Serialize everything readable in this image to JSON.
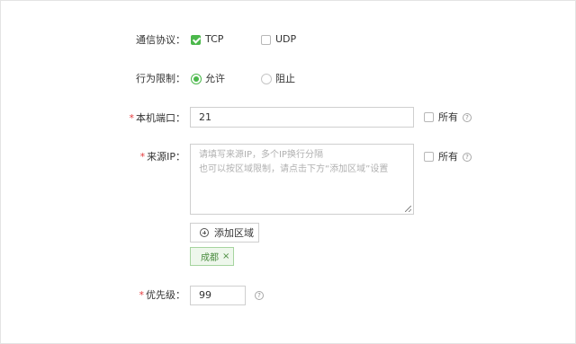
{
  "protocol": {
    "label": "通信协议：",
    "options": [
      {
        "text": "TCP",
        "checked": true
      },
      {
        "text": "UDP",
        "checked": false
      }
    ]
  },
  "behavior": {
    "label": "行为限制：",
    "options": [
      {
        "text": "允许",
        "selected": true
      },
      {
        "text": "阻止",
        "selected": false
      }
    ]
  },
  "local_port": {
    "required_mark": "*",
    "label": "本机端口：",
    "value": "21",
    "all_label": "所有",
    "help_symbol": "?"
  },
  "source_ip": {
    "required_mark": "*",
    "label": "来源IP：",
    "placeholder_line1": "请填写来源IP，多个IP换行分隔",
    "placeholder_line2": "也可以按区域限制，请点击下方“添加区域”设置",
    "all_label": "所有",
    "help_symbol": "?"
  },
  "add_region_button": "添加区域",
  "region_tags": [
    {
      "text": "成都",
      "remove": "×"
    }
  ],
  "priority": {
    "required_mark": "*",
    "label": "优先级：",
    "value": "99",
    "help_symbol": "?"
  },
  "colors": {
    "accent_green": "#4bb84b",
    "required_red": "#e4393c",
    "tag_bg": "#eef7ec",
    "tag_border": "#a6d49f"
  }
}
